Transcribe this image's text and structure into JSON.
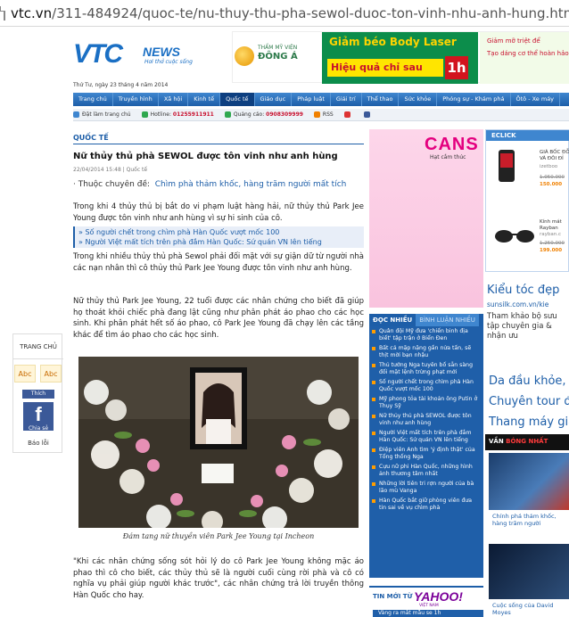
{
  "browser": {
    "url_prefix": "vtc.vn",
    "url_path": "/311-484924/quoc-te/nu-thuy-thu-pha-sewol-duoc-ton-vinh-nhu-anh-hung.htm"
  },
  "header": {
    "logo_vtc": "VTC",
    "logo_news": "NEWS",
    "slogan": "Hơi thở cuộc sống",
    "date": "Thứ Tư, ngày 23 tháng 4 năm 2014"
  },
  "banner": {
    "brand_line1": "THẨM MỸ VIỆN",
    "brand_line2": "ĐÔNG Á",
    "headline": "Giảm béo Body Laser",
    "slogan": "Hiệu quả chỉ sau",
    "hour": "1h",
    "side1": "Giảm mỡ triệt để",
    "side2": "Tạo dáng cơ thể hoàn hảo"
  },
  "nav": {
    "items": [
      "Trang chủ",
      "Truyền hình",
      "Xã hội",
      "Kinh tế",
      "Quốc tế",
      "Giáo dục",
      "Pháp luật",
      "Giải trí",
      "Thể thao",
      "Sức khỏe",
      "Phóng sự - Khám phá",
      "Ôtô - Xe máy"
    ],
    "active": 4
  },
  "toolbar": {
    "homepage": "Đặt làm trang chủ",
    "hotline_label": "Hotline:",
    "hotline": "01255911911",
    "ads_label": "Quảng cáo:",
    "ads_phone": "0908309999",
    "rss": "RSS"
  },
  "leftpanel": {
    "home": "TRANG CHỦ",
    "abc1": "Abc",
    "abc2": "Abc",
    "fb_thich": "Thích",
    "fb_letter": "f",
    "fb_share": "Chia sẻ",
    "report": "Báo lỗi"
  },
  "article": {
    "category": "QUỐC TẾ",
    "title": "Nữ thủy thủ phà SEWOL được tôn vinh như anh hùng",
    "time": "22/04/2014 15:48",
    "section": "Quốc tế",
    "topic_label": "Thuộc chuyên đề:",
    "topic_link": "Chìm phà thảm khốc, hàng trăm người mất tích",
    "p1": "Trong khi 4 thủy thủ bị bắt do vi phạm luật hàng hải, nữ thủy thủ Park Jee Young được tôn vinh như anh hùng vì sự hi sinh của cô.",
    "related": [
      "» Số người chết trong chìm phà Hàn Quốc vượt mốc 100",
      "» Người Việt mất tích trên phà đắm Hàn Quốc: Sứ quán VN lên tiếng"
    ],
    "p2": "Trong khi nhiều thủy thủ phà Sewol phải đối mặt với sự giận dữ từ người nhà các nạn nhân thì cô thủy thủ Park Jee Young được tôn vinh như anh hùng.",
    "p3": "Nữ thủy thủ Park Jee Young, 22 tuổi được các nhân chứng cho biết đã giúp họ thoát khỏi chiếc phà đang lật cũng như phân phát áo phao cho các học sinh. Khi phân phát hết số áo phao, cô Park Jee Young đã chạy lên các tầng khác để tìm áo phao cho các học sinh.",
    "caption": "Đám tang nữ thuyền viên Park Jee Young tại Incheon",
    "p4": "\"Khi các nhân chứng sống sót hỏi lý do cô Park Jee Young không mặc áo phao thì cô cho biết, các thủy thủ sẽ là người cuối cùng rời phà và cô có nghĩa vụ phải giúp người khác trước\", các nhân chứng trả lời truyền thông Hàn Quốc cho hay."
  },
  "midad": {
    "brand": "CANS",
    "sub": "Hạt cắm thúc"
  },
  "readcol": {
    "tab1": "ĐỌC NHIỀU",
    "tab2": "BÌNH LUẬN NHIỀU",
    "items": [
      "Quân đội Mỹ đưa 'chiến binh địa biết' tập trận ở Biển Đen",
      "Bất cả mặp nặng gần nửa tấn, sẽ thịt mời bạn nhậu",
      "Thủ tướng Nga tuyên bố sẵn sàng đối mặt lệnh trừng phạt mới",
      "Số người chết trong chìm phà Hàn Quốc vượt mốc 100",
      "Mỹ phong tỏa tài khoản ông Putin ở Thụy Sỹ",
      "Nữ thủy thủ phà SEWOL được tôn vinh như anh hùng",
      "Người Việt mất tích trên phà đắm Hàn Quốc: Sứ quán VN lên tiếng",
      "Điệp viên Anh tìm 'ý định thật' của Tổng thống Nga",
      "Cựu nữ phi Hàn Quốc, những hình ảnh thương tâm nhất",
      "Những lời tiên tri rợn người của bà lão mù Vanga",
      "Hàn Quốc bắt giữ phòng viên đưa tin sai về vụ chìm phà"
    ],
    "yahoo_label": "TIN MỚI TỪ",
    "yahoo": "YAHOO!",
    "yahoo_sub": "VIỆT NAM",
    "yahoo_line": "Vàng ra mắt mẫu se 1h"
  },
  "rightcol": {
    "eclick": "ECLICK",
    "prod1": "GIÁ BỐC ĐỖ VÀ ĐÔI ĐỈ",
    "prod1_site": "izetboo",
    "prod1_old": "1.050.000",
    "prod1_new": "150.000",
    "prod2": "Kính mát Rayban",
    "prod2_site": "rayban.c",
    "prod2_old": "1.250.000",
    "prod2_new": "199.000",
    "ad_title": "Kiểu tóc đẹp",
    "ad_link": "sunsilk.com.vn/kie",
    "ad_text": "Tham khảo bộ sưu tập chuyên gia & nhận ưu",
    "ads": [
      "Da đầu khỏe,",
      "Chuyên tour đ",
      "Thang máy gia"
    ],
    "video_label1": "VẦN",
    "video_label2": "BÓNG NHẤT",
    "v1": "Chính phá thảm khốc, hàng trăm người",
    "v2": "Cuộc sống của David Moyes"
  }
}
